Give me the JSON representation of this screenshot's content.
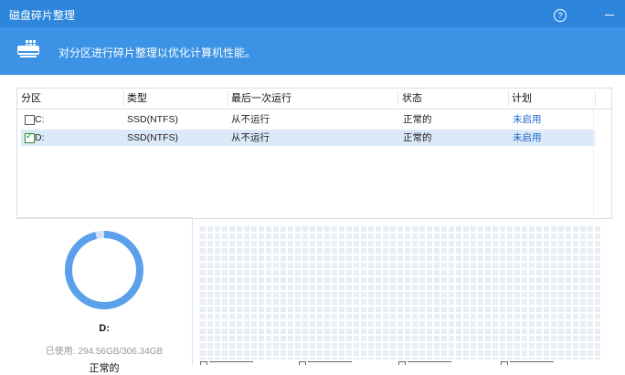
{
  "window": {
    "title": "磁盘碎片整理",
    "help_symbol": "?",
    "minimize_symbol": "-"
  },
  "banner": {
    "subtitle": "对分区进行碎片整理以优化计算机性能。",
    "icon": "disk-grid-icon"
  },
  "table": {
    "columns": [
      "分区",
      "类型",
      "最后一次运行",
      "状态",
      "计划"
    ],
    "rows": [
      {
        "partition": "C:",
        "type": "SSD(NTFS)",
        "last_run": "从不运行",
        "status": "正常的",
        "schedule": "未启用",
        "checked": false
      },
      {
        "partition": "D:",
        "type": "SSD(NTFS)",
        "last_run": "从不运行",
        "status": "正常的",
        "schedule": "未启用",
        "checked": true
      }
    ]
  },
  "details": {
    "drive": "D:",
    "usage": "已使用: 294.56GB/306.34GB",
    "usage_fraction": 0.9616,
    "status": "正常的"
  },
  "colors": {
    "titlebar": "#2d86dc",
    "banner": "#3c93e5",
    "selected_row": "#dbe9f8",
    "ring": "#5aa0ea",
    "ring_track": "#cfe3fb",
    "map_cell": "#e8eef5"
  }
}
